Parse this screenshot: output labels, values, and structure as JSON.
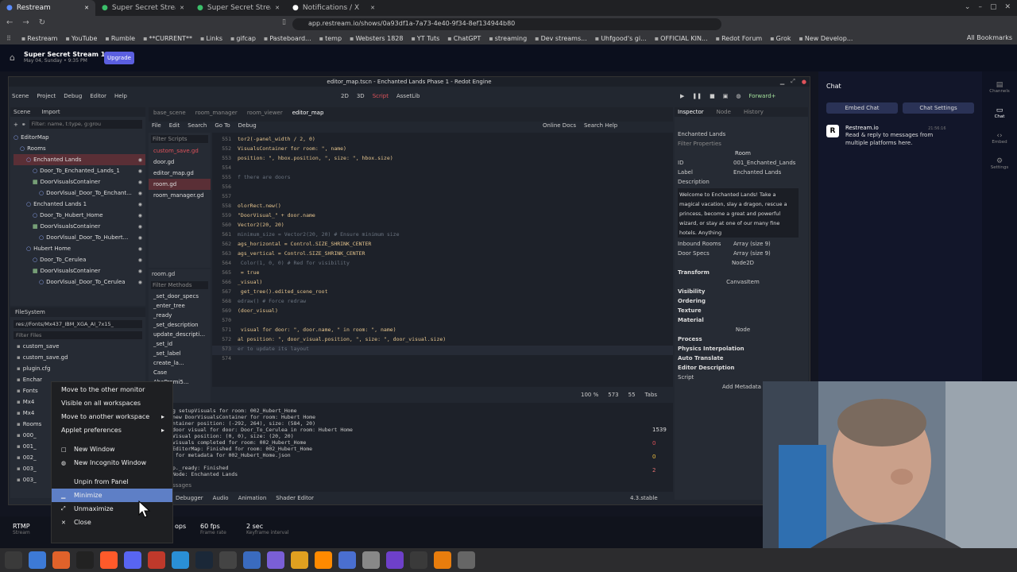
{
  "browser": {
    "tabs": [
      {
        "label": "Restream",
        "active": true
      },
      {
        "label": "Super Secret Stream 14",
        "active": false
      },
      {
        "label": "Super Secret Stream 14",
        "active": false
      },
      {
        "label": "Notifications / X",
        "active": false
      }
    ],
    "url": "app.restream.io/shows/0a93df1a-7a73-4e40-9f34-8ef134944b80",
    "bookmarks": [
      "Restream",
      "YouTube",
      "Rumble",
      "**CURRENT**",
      "Links",
      "gifcap",
      "Pasteboard...",
      "temp",
      "Websters 1828",
      "YT Tuts",
      "ChatGPT",
      "streaming",
      "Dev streams...",
      "Uhfgood's gi...",
      "OFFICIAL KIN...",
      "Redot Forum",
      "Grok",
      "New Develop..."
    ],
    "all_bookmarks": "All Bookmarks"
  },
  "restream": {
    "show_title": "Super Secret Stream 14",
    "show_date": "May 04, Sunday • 9:35 PM",
    "upgrade": "Upgrade",
    "chat_title": "Chat",
    "embed_chat": "Embed Chat",
    "chat_settings": "Chat Settings",
    "bot_name": "Restream.io",
    "bot_time": "21:56:16",
    "bot_message": "Read & reply to messages from multiple platforms here.",
    "nav": [
      "Channels",
      "Chat",
      "Embed",
      "Settings"
    ],
    "bottom": {
      "rtmp": "RTMP",
      "rtmp_sub": "Stream",
      "res": "ops",
      "fps": "60 fps",
      "fps_label": "Frame rate",
      "keyframe": "2 sec",
      "keyframe_label": "Keyframe interval"
    }
  },
  "godot": {
    "window_title": "editor_map.tscn - Enchanted Lands Phase 1 - Redot Engine",
    "menus": [
      "Scene",
      "Project",
      "Debug",
      "Editor",
      "Help"
    ],
    "modes": [
      "2D",
      "3D",
      "Script",
      "AssetLib"
    ],
    "renderer": "Forward+",
    "scene_tabs": [
      "Scene",
      "Import"
    ],
    "filter_nodes": "Filter: name, t:type, g:grou",
    "tree": [
      {
        "label": "EditorMap",
        "indent": 0
      },
      {
        "label": "Rooms",
        "indent": 1
      },
      {
        "label": "Enchanted Lands",
        "indent": 2,
        "selected": true
      },
      {
        "label": "Door_To_Enchanted_Lands_1",
        "indent": 3
      },
      {
        "label": "DoorVisualsContainer",
        "indent": 3
      },
      {
        "label": "DoorVisual_Door_To_Enchant...",
        "indent": 4
      },
      {
        "label": "Enchanted Lands 1",
        "indent": 2
      },
      {
        "label": "Door_To_Hubert_Home",
        "indent": 3
      },
      {
        "label": "DoorVisualsContainer",
        "indent": 3
      },
      {
        "label": "DoorVisual_Door_To_Hubert...",
        "indent": 4
      },
      {
        "label": "Hubert Home",
        "indent": 2
      },
      {
        "label": "Door_To_Cerulea",
        "indent": 3
      },
      {
        "label": "DoorVisualsContainer",
        "indent": 3
      },
      {
        "label": "DoorVisual_Door_To_Cerulea",
        "indent": 4
      }
    ],
    "filesystem": {
      "title": "FileSystem",
      "path": "res://Fonts/Mx437_IBM_XGA_AI_7x15_",
      "filter": "Filter Files",
      "items": [
        "custom_save",
        "custom_save.gd",
        "plugin.cfg",
        "Enchar",
        "Fonts",
        "Mx4",
        "Mx4",
        "Rooms",
        "000_",
        "001_",
        "002_",
        "003_",
        "003_"
      ]
    },
    "editor_tabs": [
      "base_scene",
      "room_manager",
      "room_viewer",
      "editor_map"
    ],
    "script_menus": [
      "File",
      "Edit",
      "Search",
      "Go To",
      "Debug"
    ],
    "online_docs": "Online Docs",
    "search_help": "Search Help",
    "filter_scripts": "Filter Scripts",
    "scripts": [
      "custom_save.gd",
      "door.gd",
      "editor_map.gd",
      "room.gd",
      "room_manager.gd"
    ],
    "current_script": "room.gd",
    "filter_methods": "Filter Methods",
    "methods": [
      "_set_door_specs",
      "_enter_tree",
      "_ready",
      "_set_description",
      "update_descripti...",
      "_set_id",
      "_set_label",
      "create_la...",
      "Case",
      "AbePromi5..."
    ],
    "code_lines": [
      {
        "n": "551",
        "t": "tor2(-panel_width / 2, 0)"
      },
      {
        "n": "552",
        "t": "VisualsContainer for room: \", name)"
      },
      {
        "n": "553",
        "t": "position: \", hbox.position, \", size: \", hbox.size)"
      },
      {
        "n": "554",
        "t": ""
      },
      {
        "n": "555",
        "t": "f there are doors"
      },
      {
        "n": "556",
        "t": ""
      },
      {
        "n": "557",
        "t": ""
      },
      {
        "n": "558",
        "t": "olorRect.new()"
      },
      {
        "n": "559",
        "t": "\"DoorVisual_\" + door.name"
      },
      {
        "n": "560",
        "t": "Vector2(20, 20)"
      },
      {
        "n": "561",
        "t": "minimum_size = Vector2(20, 20) # Ensure minimum size"
      },
      {
        "n": "562",
        "t": "ags_horizontal = Control.SIZE_SHRINK_CENTER"
      },
      {
        "n": "563",
        "t": "ags_vertical = Control.SIZE_SHRINK_CENTER"
      },
      {
        "n": "564",
        "t": " Color(1, 0, 0) # Red for visibility"
      },
      {
        "n": "565",
        "t": " = true"
      },
      {
        "n": "566",
        "t": "_visual)"
      },
      {
        "n": "567",
        "t": " get_tree().edited_scene_root"
      },
      {
        "n": "568",
        "t": "edraw() # Force redraw"
      },
      {
        "n": "569",
        "t": "(door_visual)"
      },
      {
        "n": "570",
        "t": ""
      },
      {
        "n": "571",
        "t": " visual for door: \", door.name, \" in room: \", name)"
      },
      {
        "n": "572",
        "t": "al position: \", door_visual.position, \", size: \", door_visual.size)"
      },
      {
        "n": "573",
        "t": "er to update its layout"
      },
      {
        "n": "574",
        "t": ""
      }
    ],
    "status": {
      "zoom": "100 %",
      "line": "573",
      "col": "55",
      "indent": "Tabs"
    },
    "output_lines": [
      "g setupVisuals for room: 002_Hubert_Home",
      "new DoorVisualsContainer for room: Hubert Home",
      "ntainer position: (-292, 264), size: (584, 20)",
      "door visual for door: Door_To_Cerulea in room: Hubert Home",
      "Visual position: (0, 0), size: (20, 20)",
      "visuals completed for room: 002_Hubert_Home",
      "EditorMap: Finished for room: 002_Hubert_Home",
      " for metadata for 002_Hubert_Home.json",
      "",
      "p._ready: Finished",
      "Node: Enchanted Lands"
    ],
    "output_counts": [
      "1539",
      "0",
      "0",
      "2"
    ],
    "bottom_tabs": [
      "Debugger",
      "Audio",
      "Animation",
      "Shader Editor"
    ],
    "version": "4.3.stable",
    "messages_label": "ssages",
    "inspector": {
      "tabs": [
        "Inspector",
        "Node",
        "History"
      ],
      "object": "Enchanted Lands",
      "filter": "Filter Properties",
      "class_room": "Room",
      "id_label": "ID",
      "id_value": "001_Enchanted_Lands",
      "label_label": "Label",
      "label_value": "Enchanted Lands",
      "description_label": "Description",
      "description": "Welcome to Enchanted Lands! Take a magical vacation, slay a dragon, rescue a princess, become a great and powerful wizard, or stay at one of our many fine hotels. Anything",
      "inbound_label": "Inbound Rooms",
      "inbound_value": "Array (size 9)",
      "doors_label": "Door Specs",
      "doors_value": "Array (size 9)",
      "class_node2d": "Node2D",
      "transform": "Transform",
      "class_canvas": "CanvasItem",
      "canvas_sections": [
        "Visibility",
        "Ordering",
        "Texture",
        "Material"
      ],
      "class_node": "Node",
      "node_sections": [
        "Process",
        "Physics Interpolation",
        "Auto Translate",
        "Editor Description"
      ],
      "script_label": "Script",
      "add_metadata": "Add Metadata"
    }
  },
  "context_menu": {
    "items": [
      {
        "label": "Move to the other monitor",
        "icon": "",
        "sub": false
      },
      {
        "label": "Visible on all workspaces",
        "icon": "",
        "sub": false
      },
      {
        "label": "Move to another workspace",
        "icon": "",
        "sub": true
      },
      {
        "label": "Applet preferences",
        "icon": "",
        "sub": true
      },
      {
        "label": "New Window",
        "icon": "□",
        "sub": false
      },
      {
        "label": "New Incognito Window",
        "icon": "◍",
        "sub": false
      },
      {
        "label": "Unpin from Panel",
        "icon": "",
        "sub": false
      },
      {
        "label": "Minimize",
        "icon": "▁",
        "sub": false,
        "highlight": true
      },
      {
        "label": "Unmaximize",
        "icon": "⤢",
        "sub": false
      },
      {
        "label": "Close",
        "icon": "✕",
        "sub": false
      }
    ]
  },
  "taskbar": {
    "icons": [
      "mint-menu-icon",
      "files-icon",
      "firefox-icon",
      "terminal-icon",
      "brave-icon",
      "discord-icon",
      "godot-bug-icon",
      "vscode-icon",
      "steam-icon",
      "server-icon",
      "camera-icon",
      "notes-icon",
      "chrome-icon",
      "vlc-icon",
      "mail-icon",
      "text-icon",
      "github-icon",
      "obs-icon",
      "blender-icon",
      "settings-icon"
    ]
  },
  "colors": {
    "accent": "#5e7fc6",
    "restream_purple": "#5b5fe0",
    "godot_red": "#e0525a",
    "code_green": "#a3e09b",
    "code_key": "#f0a37a"
  }
}
